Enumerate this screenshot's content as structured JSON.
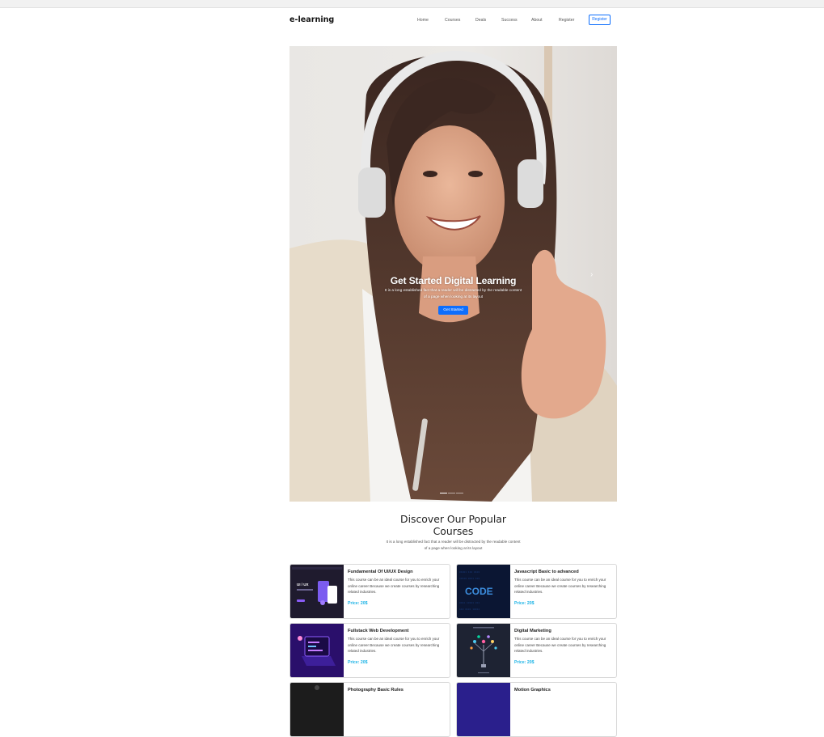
{
  "nav": {
    "brand": "e-learning",
    "links": [
      "Home",
      "Courses",
      "Deals",
      "Success",
      "About",
      "Register"
    ],
    "register_button": "Register"
  },
  "hero": {
    "title": "Get Started Digital Learning",
    "text": "It is a long established fact that a reader will be distracted by the readable content of a page when looking at its layout",
    "button": "Get Started",
    "next_icon": "chevron-right-icon",
    "slides_count": 3,
    "active_slide": 1
  },
  "popular": {
    "title": "Discover Our Popular Courses",
    "subtitle": "It is a long established fact that a reader will be distracted by the readable content of a page when looking at its layout"
  },
  "courses": [
    {
      "title": "Fundamental Of UI/UX Design",
      "text": "This course can be an ideal course for you to enrich your online career Because we create courses by researching related industries.",
      "price": "Price: 20$"
    },
    {
      "title": "Javascript Basic to advanced",
      "text": "This course can be an ideal course for you to enrich your online career Because we create courses by researching related industries.",
      "price": "Price: 20$"
    },
    {
      "title": "Fullstack Web Development",
      "text": "This course can be an ideal course for you to enrich your online career Because we create courses by researching related industries.",
      "price": "Price: 20$"
    },
    {
      "title": "Digital Marketing",
      "text": "This course can be an ideal course for you to enrich your online career Because we create courses by researching related industries.",
      "price": "Price: 20$"
    },
    {
      "title": "Photography Basic Rules",
      "text": "",
      "price": ""
    },
    {
      "title": "Motion Graphics",
      "text": "",
      "price": ""
    }
  ],
  "thumbs": {
    "uiux_heading": "UI / UX",
    "code_word": "CODE"
  },
  "colors": {
    "accent": "#0d6efd",
    "price": "#1eb4e6"
  }
}
